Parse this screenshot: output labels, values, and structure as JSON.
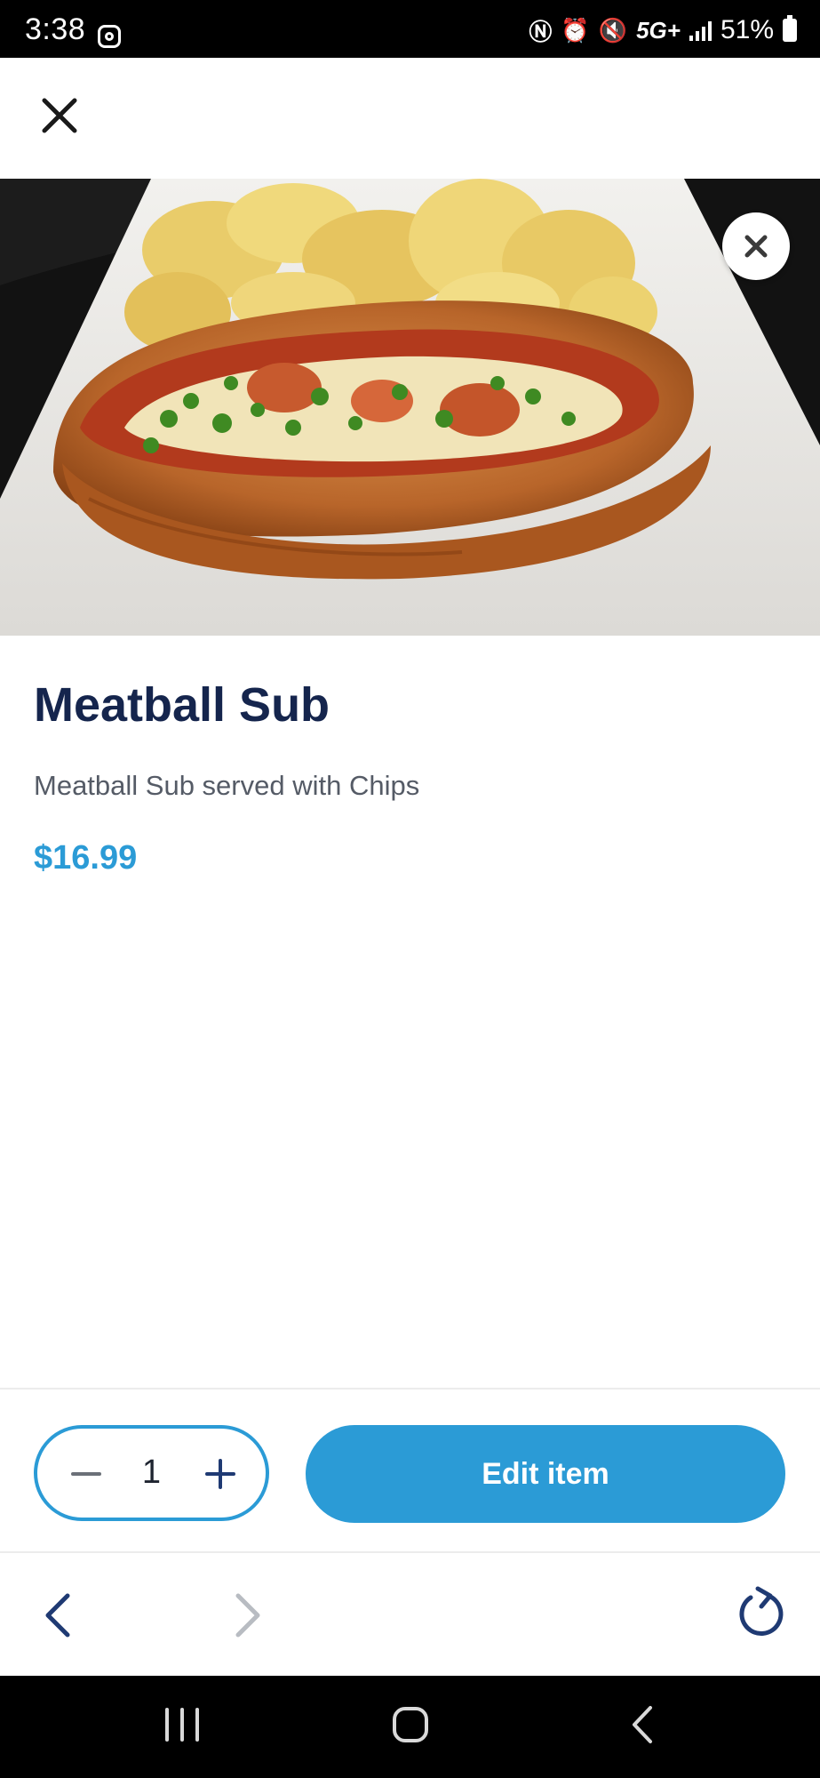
{
  "status_bar": {
    "time": "3:38",
    "network": "5G+",
    "battery": "51%",
    "icons": [
      "instagram-icon",
      "nfc-icon",
      "alarm-icon",
      "mute-icon",
      "network-5g-icon",
      "signal-icon",
      "battery-icon"
    ]
  },
  "header": {
    "close_icon": "close-icon"
  },
  "hero": {
    "image_subject": "meatball-sub-with-chips",
    "close_icon": "close-icon"
  },
  "item": {
    "name": "Meatball Sub",
    "description": "Meatball Sub served with Chips",
    "price": "$16.99"
  },
  "quantity": {
    "value": "1",
    "decrement_icon": "minus-icon",
    "increment_icon": "plus-icon"
  },
  "actions": {
    "edit_label": "Edit item"
  },
  "browser_nav": {
    "icons": [
      "chevron-left-icon",
      "chevron-right-icon",
      "reload-icon"
    ]
  },
  "system_nav": {
    "icons": [
      "recents-icon",
      "home-icon",
      "back-icon"
    ]
  },
  "colors": {
    "accent": "#2b9bd6",
    "title": "#15254d",
    "description": "#555b66",
    "nav_icon": "#1f3a73",
    "nav_icon_disabled": "#b8bcc2"
  }
}
